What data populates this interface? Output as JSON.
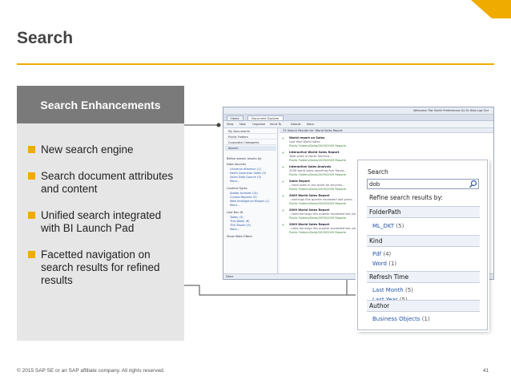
{
  "slide": {
    "title": "Search",
    "footer_text": "© 2015 SAP SE or an SAP affiliate company. All rights reserved.",
    "page_number": "41",
    "colors": {
      "accent": "#f0ab00",
      "panel_header": "#7a7a7a",
      "panel_bg": "#e6e6e6"
    }
  },
  "panel": {
    "heading": "Search Enhancements",
    "bullets": [
      "New search engine",
      "Search document attributes and content",
      "Unified search integrated with BI Launch Pad",
      "Facetted navigation on search results for refined results"
    ]
  },
  "screenshot": {
    "welcome": "Welcome: Pat Smith   Preferences   Go To   Help   Log Out",
    "tabs": [
      "Home",
      "Document Explorer"
    ],
    "toolbar": [
      "View",
      "New",
      "Organize",
      "Send To",
      "Details",
      "More"
    ],
    "left_nav": [
      "My Documents",
      "Public Folders",
      "Corporate Categories",
      "Search"
    ],
    "refine_heading": "Refine search results by:",
    "left_groups": [
      {
        "label": "Data Sources",
        "items": [
          "Universe eFashion (1)",
          "North American Sales (5)",
          "Sales Data Source (3)",
          "More..."
        ]
      },
      {
        "label": "Content Types",
        "items": [
          "Adobe Acrobat (14)",
          "Crystal Reports (9)",
          "Web Intelligence Report (1)",
          "More..."
        ]
      },
      {
        "label": "Last Run At",
        "items": [
          "Today (3)",
          "This Week (8)",
          "This Month (9)",
          "More..."
        ]
      },
      {
        "label": "Show Meta Filters",
        "items": []
      }
    ],
    "results_header": "23 Search Results for: World Sales Report",
    "results": [
      {
        "title": "World report on Sales",
        "lines": [
          "Last Year World Sales",
          "Public Folders/Sales/2009/2009 Reports"
        ]
      },
      {
        "title": "Interactive World Sales Report",
        "lines": [
          "Total sales in North America...",
          "Public Folders/Sales/2009/2009 Reports"
        ]
      },
      {
        "title": "Interactive Sales Analysis",
        "lines": [
          "2009 world sales reporting Ann Figure...",
          "Public Folders/Sales/2009/2009 Reports"
        ]
      },
      {
        "title": "Sales Report",
        "lines": [
          "...total sales in the world for bicycles...",
          "Public Folders/Sales/2009/2009 Reports"
        ]
      },
      {
        "title": "2009 World Sales Report",
        "lines": [
          "...earnings this quarter exceeded last years...",
          "Public Folders/Sales/2009/2009 Reports"
        ]
      },
      {
        "title": "2009 World Sales Report",
        "lines": [
          "...total earnings this quarter exceeded last years...",
          "Public Folders/Sales/2009/2009 Reports"
        ]
      },
      {
        "title": "2009 World Sales Report",
        "lines": [
          "...total earnings this quarter exceeded last years...",
          "Public Folders/Sales/2009/2009 Reports"
        ]
      }
    ],
    "status": "Done"
  },
  "search_panel": {
    "label": "Search",
    "query": "dob",
    "refine_label": "Refine search results by:",
    "facets": [
      {
        "label": "FolderPath",
        "items": [
          {
            "name": "ML_DKT",
            "count": "(5)"
          }
        ]
      },
      {
        "label": "Kind",
        "items": [
          {
            "name": "Pdf",
            "count": "(4)"
          },
          {
            "name": "Word",
            "count": "(1)"
          }
        ]
      },
      {
        "label": "Refresh Time",
        "items": [
          {
            "name": "Last Month",
            "count": "(5)"
          },
          {
            "name": "Last Year",
            "count": "(5)"
          }
        ]
      },
      {
        "label": "Author",
        "items": [
          {
            "name": "Business Objects",
            "count": "(1)"
          }
        ]
      }
    ]
  }
}
